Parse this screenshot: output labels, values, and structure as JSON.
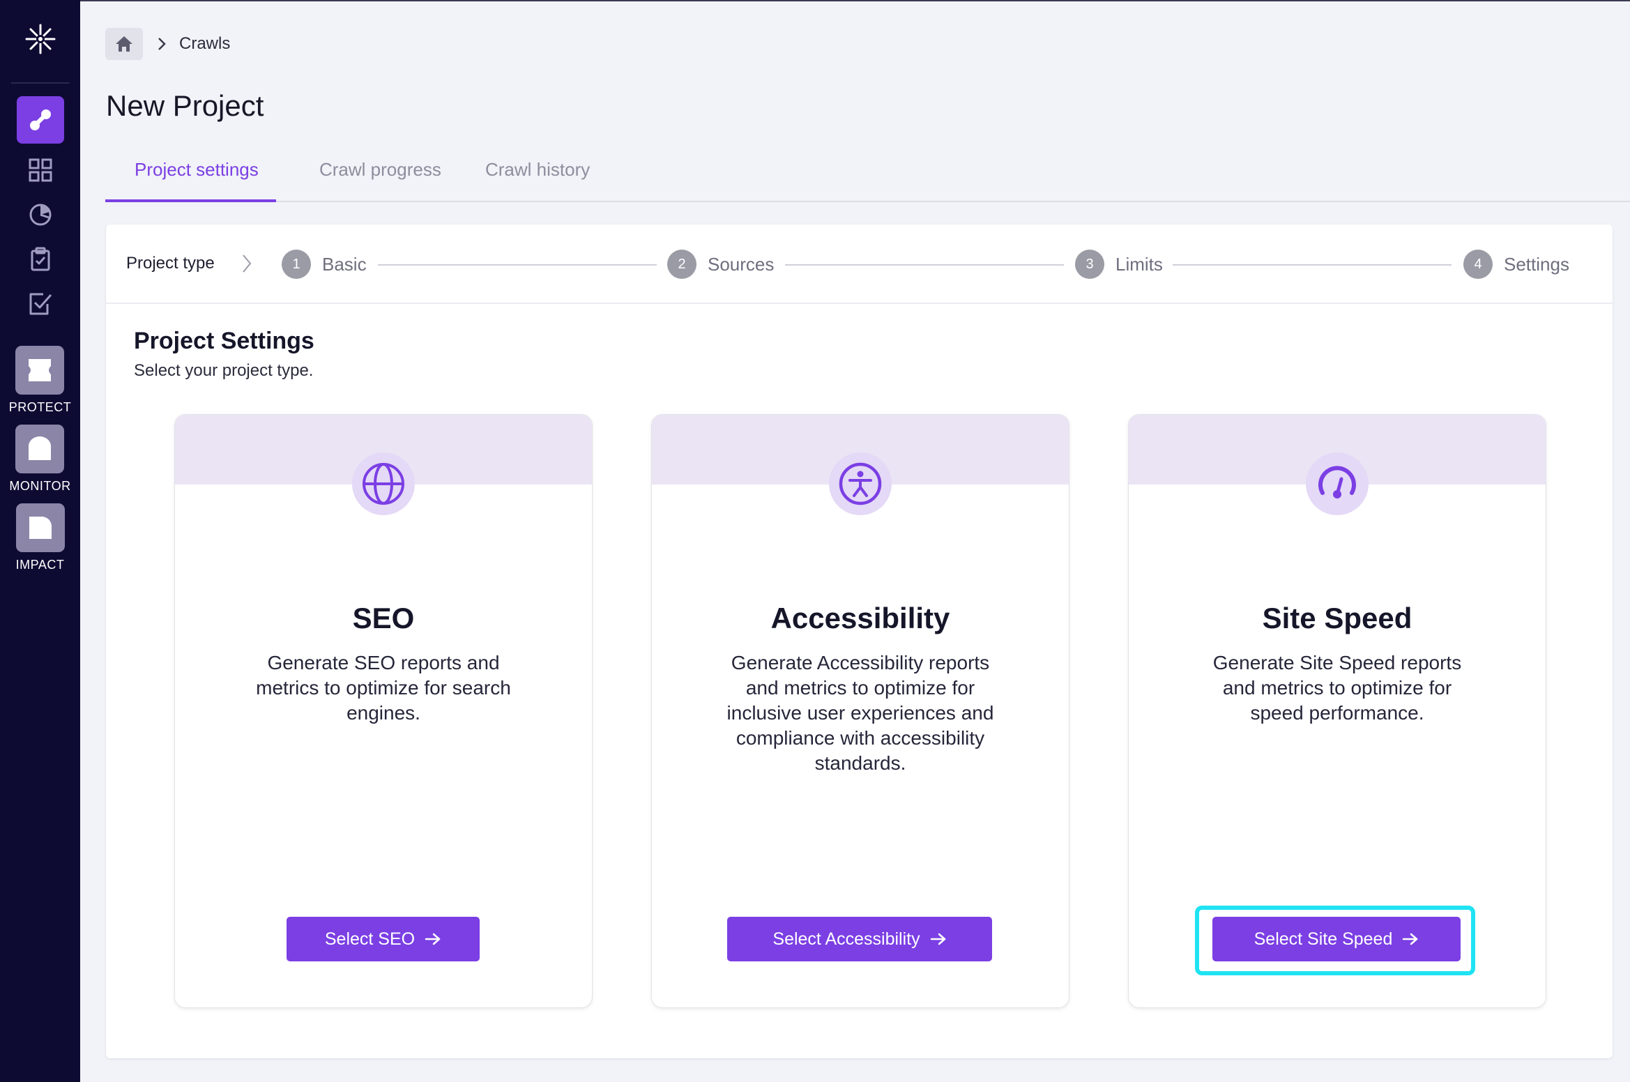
{
  "sidebar": {
    "apps": [
      {
        "label": "PROTECT"
      },
      {
        "label": "MONITOR"
      },
      {
        "label": "IMPACT"
      }
    ]
  },
  "breadcrumb": {
    "current": "Crawls"
  },
  "page": {
    "title": "New Project"
  },
  "tabs": [
    {
      "label": "Project settings",
      "active": true
    },
    {
      "label": "Crawl progress",
      "active": false
    },
    {
      "label": "Crawl history",
      "active": false
    }
  ],
  "stepper": {
    "type_label": "Project type",
    "steps": [
      {
        "num": "1",
        "label": "Basic"
      },
      {
        "num": "2",
        "label": "Sources"
      },
      {
        "num": "3",
        "label": "Limits"
      },
      {
        "num": "4",
        "label": "Settings"
      }
    ]
  },
  "settings": {
    "title": "Project Settings",
    "subtitle": "Select your project type."
  },
  "cards": [
    {
      "icon": "globe-icon",
      "title": "SEO",
      "description": "Generate SEO reports and metrics to optimize for search engines.",
      "button": "Select SEO"
    },
    {
      "icon": "accessibility-icon",
      "title": "Accessibility",
      "description": "Generate Accessibility reports and metrics to optimize for inclusive user experiences and compliance with accessibility standards.",
      "button": "Select Accessibility"
    },
    {
      "icon": "speedometer-icon",
      "title": "Site Speed",
      "description": "Generate Site Speed reports and metrics to optimize for speed performance.",
      "button": "Select Site Speed"
    }
  ],
  "colors": {
    "sidebar_bg": "#0e0b33",
    "accent": "#7b3fe4",
    "highlight": "#1fe3f2",
    "card_header": "#ebe4f5"
  }
}
